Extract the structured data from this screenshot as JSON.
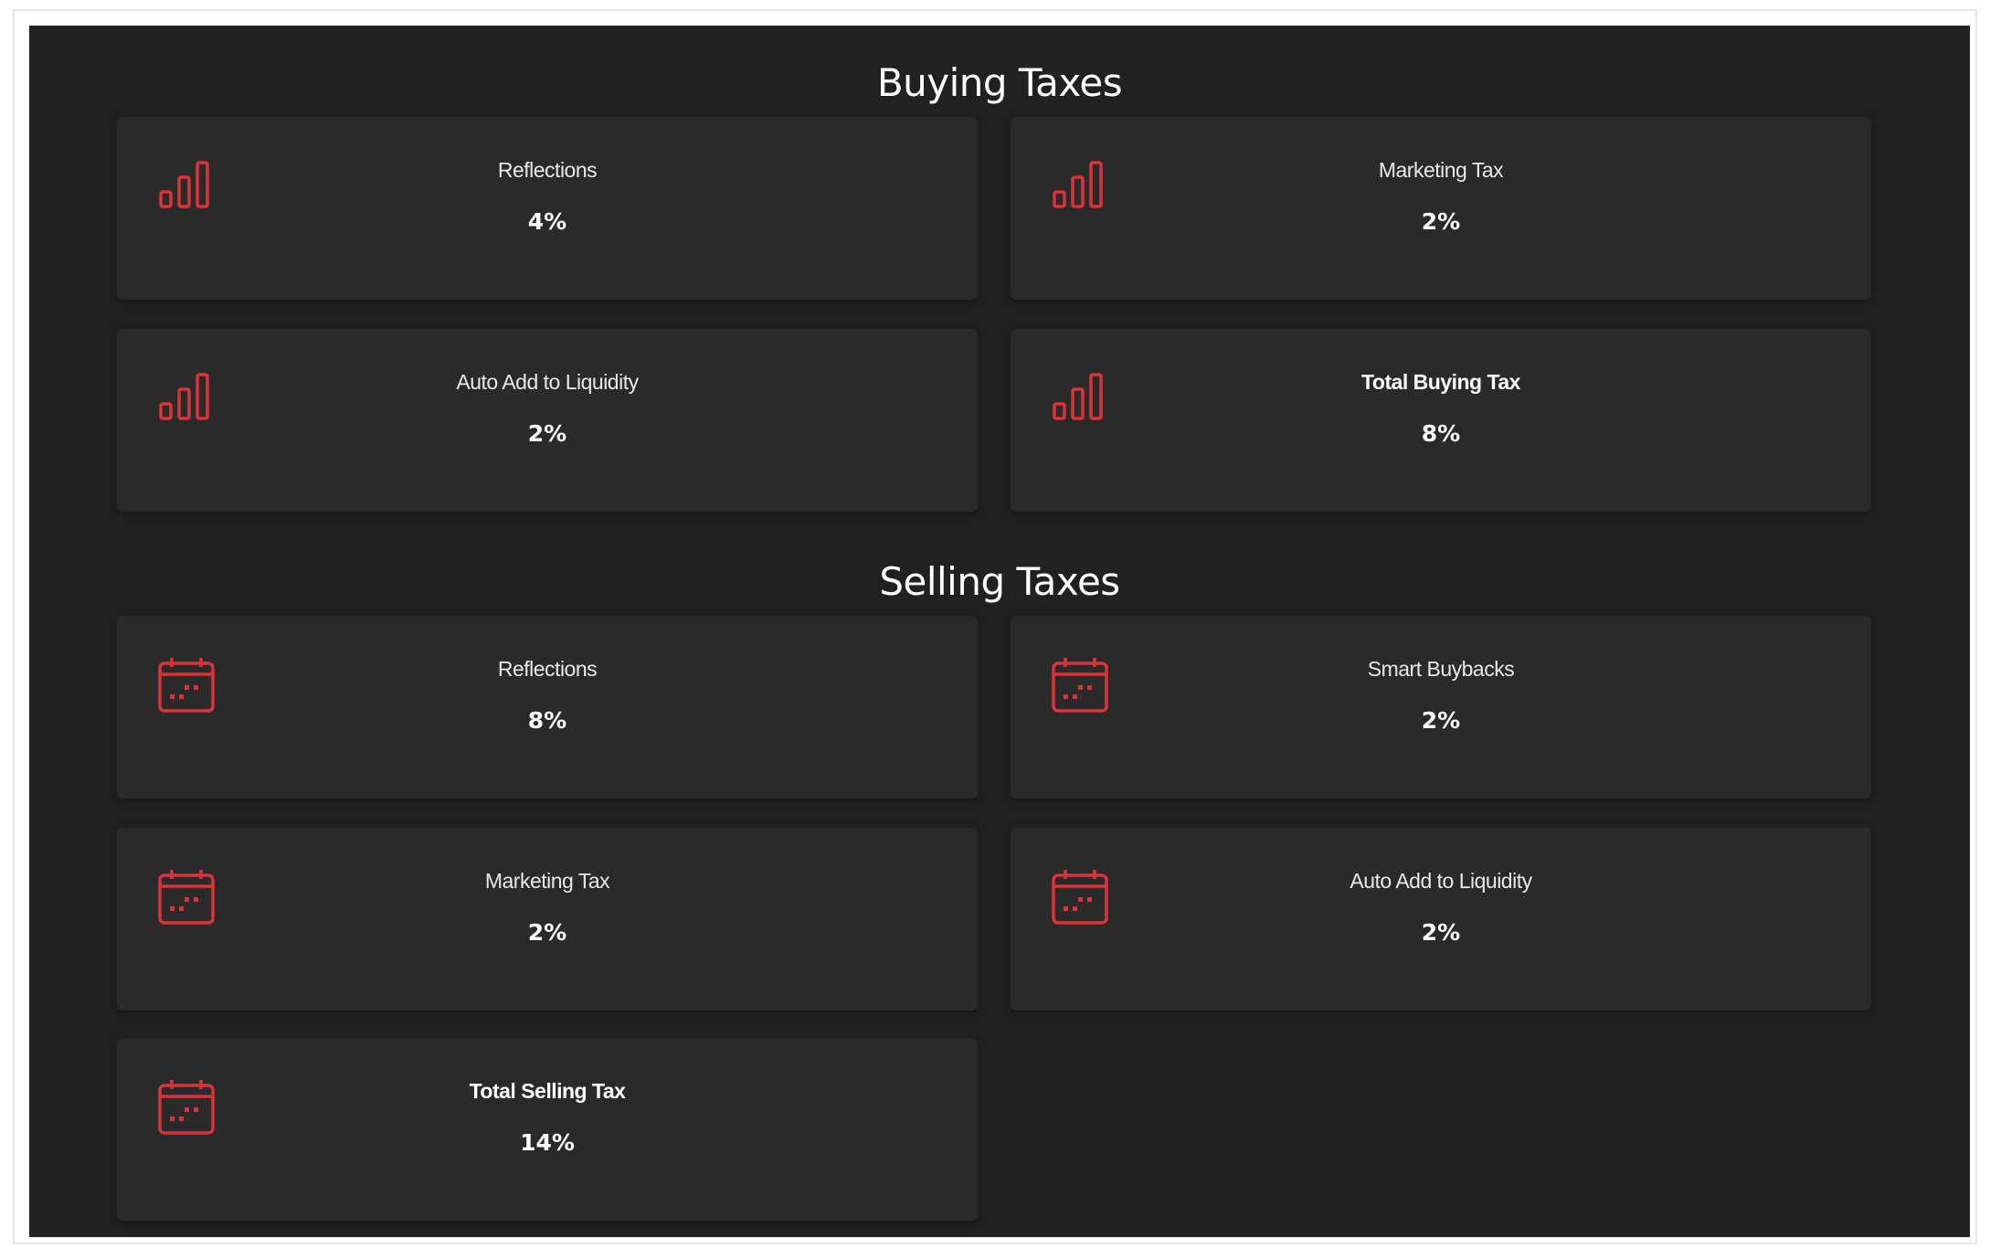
{
  "buying": {
    "title": "Buying Taxes",
    "items": [
      {
        "label": "Reflections",
        "value": "4%",
        "icon": "bar-chart-icon"
      },
      {
        "label": "Marketing Tax",
        "value": "2%",
        "icon": "bar-chart-icon"
      },
      {
        "label": "Auto Add to Liquidity",
        "value": "2%",
        "icon": "bar-chart-icon"
      },
      {
        "label": "Total Buying Tax",
        "value": "8%",
        "icon": "bar-chart-icon"
      }
    ]
  },
  "selling": {
    "title": "Selling Taxes",
    "items": [
      {
        "label": "Reflections",
        "value": "8%",
        "icon": "calendar-icon"
      },
      {
        "label": "Smart Buybacks",
        "value": "2%",
        "icon": "calendar-icon"
      },
      {
        "label": "Marketing Tax",
        "value": "2%",
        "icon": "calendar-icon"
      },
      {
        "label": "Auto Add to Liquidity",
        "value": "2%",
        "icon": "calendar-icon"
      },
      {
        "label": "Total Selling Tax",
        "value": "14%",
        "icon": "calendar-icon"
      }
    ]
  },
  "colors": {
    "background": "#212121",
    "card": "#2a2a2b",
    "accent": "#d8343a",
    "text": "#ffffff"
  }
}
